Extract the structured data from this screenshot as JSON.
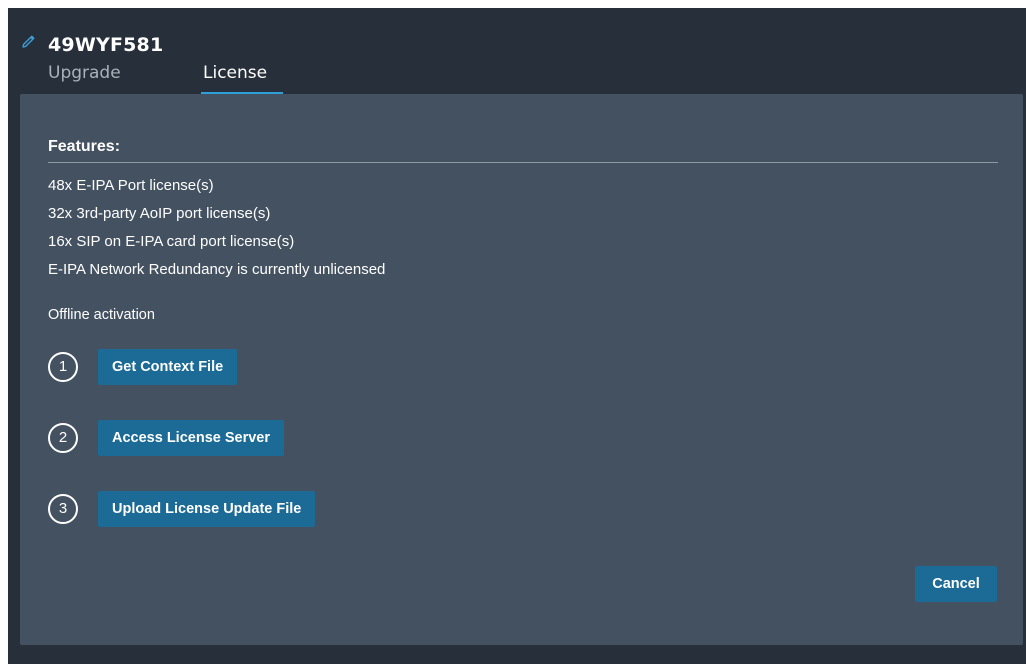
{
  "device": {
    "name": "49WYF581",
    "icon": "pencil-icon"
  },
  "tabs": [
    {
      "label": "Upgrade",
      "active": false
    },
    {
      "label": "License",
      "active": true
    }
  ],
  "features": {
    "title": "Features:",
    "items": [
      "48x E-IPA Port license(s)",
      "32x 3rd-party AoIP port license(s)",
      "16x SIP on E-IPA card port license(s)",
      "E-IPA Network Redundancy is currently unlicensed"
    ]
  },
  "offline_activation": {
    "title": "Offline activation",
    "steps": [
      {
        "number": "1",
        "button_label": "Get Context File"
      },
      {
        "number": "2",
        "button_label": "Access License Server"
      },
      {
        "number": "3",
        "button_label": "Upload License Update File"
      }
    ]
  },
  "actions": {
    "cancel_label": "Cancel"
  },
  "colors": {
    "window_bg": "#262f3a",
    "panel_bg": "#435161",
    "button_bg": "#1c6a96",
    "tab_accent": "#2e9fd8"
  }
}
